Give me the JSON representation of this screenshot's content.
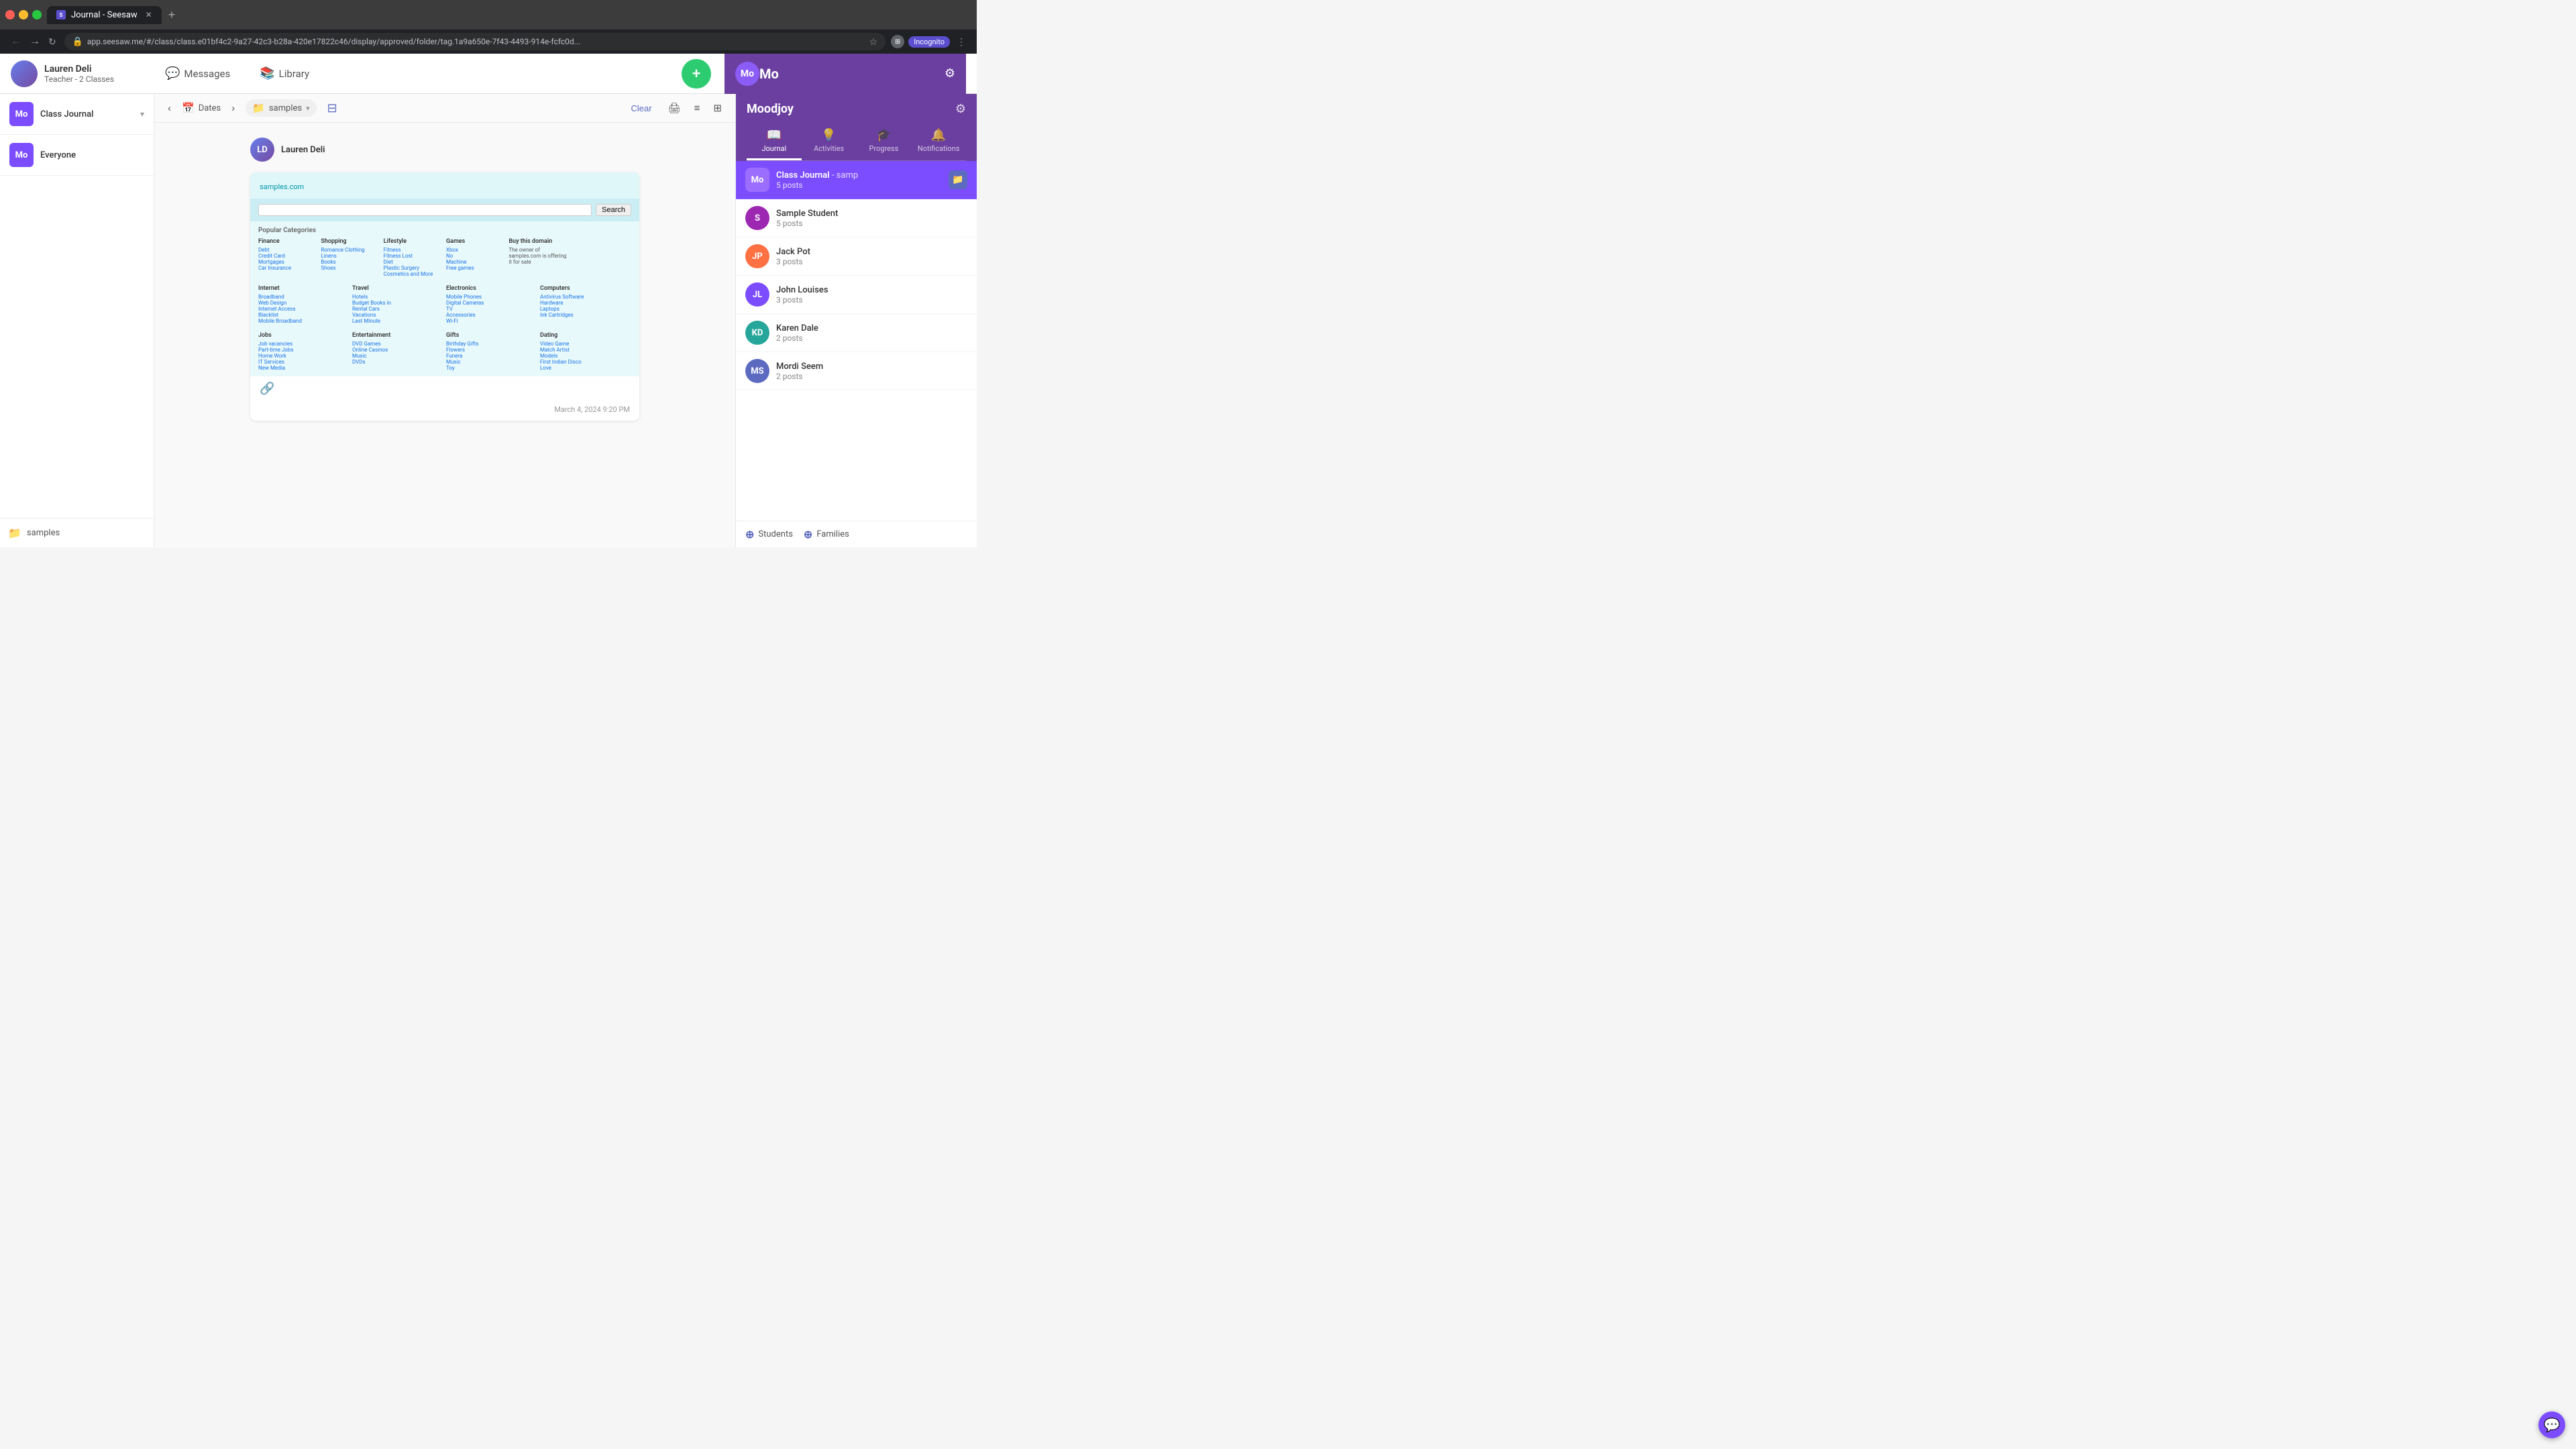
{
  "browser": {
    "tab_label": "Journal - Seesaw",
    "url": "app.seesaw.me/#/class/class.e01bf4c2-9a27-42c3-b28a-420e17822c46/display/approved/folder/tag.1a9a650e-7f43-4493-914e-fcfc0d...",
    "new_tab_icon": "+",
    "window_title": "8 Journal Seesaw",
    "incognito_label": "Incognito"
  },
  "top_nav": {
    "user_name": "Lauren Deli",
    "user_role": "Teacher - 2 Classes",
    "messages_label": "Messages",
    "library_label": "Library",
    "add_label": "Add"
  },
  "right_header": {
    "initials": "Mo",
    "display_name": "Moodjoy",
    "settings_icon": "⚙"
  },
  "left_sidebar": {
    "journal_label": "Class Journal",
    "journal_initials": "Mo",
    "everyone_label": "Everyone",
    "everyone_initials": "Mo",
    "bottom_folder": "samples"
  },
  "toolbar": {
    "back_icon": "‹",
    "dates_label": "Dates",
    "forward_icon": "›",
    "folder_label": "samples",
    "clear_label": "Clear",
    "filter_icon": "⊟",
    "print_icon": "🖨",
    "list_icon": "≡",
    "grid_icon": "⊞"
  },
  "post": {
    "user_name": "Lauren Deli",
    "link_url": "samples.com",
    "search_placeholder": "",
    "search_btn": "Search",
    "categories": [
      {
        "title": "Finance",
        "links": [
          "Debt",
          "Credit Card",
          "Mortgages",
          "Car Insurance"
        ]
      },
      {
        "title": "Shopping",
        "links": [
          "Romance Clothing",
          "Linens",
          "Books",
          "Shoes"
        ]
      },
      {
        "title": "Lifestyle",
        "links": [
          "Fitness",
          "Fitness Lost",
          "Diet",
          "Plastic Surgery",
          "Cosmetics and More"
        ]
      },
      {
        "title": "Games",
        "links": [
          "Xbox",
          "No",
          "Machine",
          "Free games"
        ]
      },
      {
        "title": "Buy this domain",
        "links": [
          "The owner of samples.com is offering it for sale"
        ]
      },
      {
        "title": "",
        "links": []
      }
    ],
    "categories2": [
      {
        "title": "Internet",
        "links": [
          "Broadband",
          "Web Design",
          "Internet Access",
          "Blacklist",
          "Mobile Broadband"
        ]
      },
      {
        "title": "Travel",
        "links": [
          "Hotels",
          "Budget Books in",
          "Rental Cars",
          "Vacations",
          "Last Minute"
        ]
      },
      {
        "title": "Electronics",
        "links": [
          "Mobile Phones",
          "Digital Cameras",
          "TV",
          "Accessories",
          "Wi-Fi"
        ]
      },
      {
        "title": "Computers",
        "links": [
          "Antivirus Software",
          "Hardware",
          "Laptops",
          "Ink Cartridges"
        ]
      }
    ],
    "categories3": [
      {
        "title": "Jobs",
        "links": [
          "Job vacancies",
          "Part-time Jobs",
          "Home Work",
          "IT Services",
          "New Media"
        ]
      },
      {
        "title": "Entertainment",
        "links": [
          "DVD Games",
          "Online Casinos",
          "Music",
          "DVDs"
        ]
      },
      {
        "title": "Gifts",
        "links": [
          "Birthday Gifts",
          "Flowers",
          "Funera",
          "Music",
          "Toy"
        ]
      },
      {
        "title": "Dating",
        "links": [
          "Video Game",
          "Match Artist",
          "Models",
          "First Indian Disco",
          "Love"
        ]
      }
    ],
    "timestamp": "March 4, 2024 9:20 PM",
    "link_icon": "🔗"
  },
  "right_panel": {
    "tabs": [
      {
        "label": "Journal",
        "icon": "📖",
        "active": true
      },
      {
        "label": "Activities",
        "icon": "💡",
        "active": false
      },
      {
        "label": "Progress",
        "icon": "🎓",
        "active": false
      },
      {
        "label": "Notifications",
        "icon": "🔔",
        "active": false
      }
    ],
    "class_journal": {
      "name": "Class Journal",
      "folder": "- samp",
      "posts": "5 posts"
    },
    "students": [
      {
        "name": "Sample Student",
        "posts": "5 posts",
        "initials": "S",
        "color": "#9c27b0"
      },
      {
        "name": "Jack Pot",
        "posts": "3 posts",
        "initials": "JP",
        "color": "#ff7043"
      },
      {
        "name": "John Louises",
        "posts": "3 posts",
        "initials": "JL",
        "color": "#7c4dff"
      },
      {
        "name": "Karen Dale",
        "posts": "2 posts",
        "initials": "KD",
        "color": "#26a69a"
      },
      {
        "name": "Mordi Seem",
        "posts": "2 posts",
        "initials": "MS",
        "color": "#5c6bc0"
      }
    ],
    "add_students_label": "Students",
    "add_families_label": "Families"
  },
  "chat_icon": "💬"
}
